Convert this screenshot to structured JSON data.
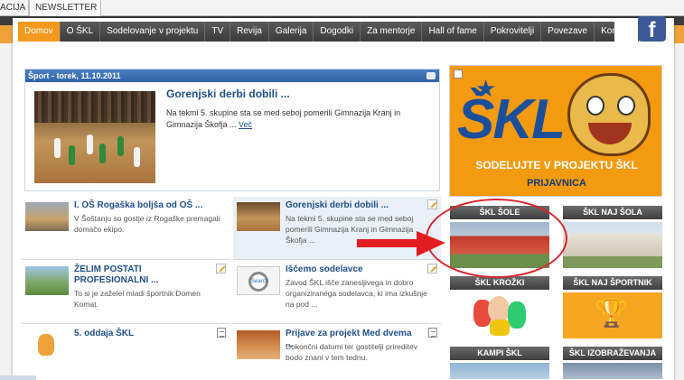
{
  "top_tabs": [
    "ACIJA",
    "NEWSLETTER"
  ],
  "nav": {
    "items": [
      "Domov",
      "O ŠKL",
      "Sodelovanje v projektu",
      "TV",
      "Revija",
      "Galerija",
      "Dogodki",
      "Za mentorje",
      "Hall of fame",
      "Pokrovitelji",
      "Povezave",
      "Kontakt"
    ],
    "active": "Domov",
    "facebook": "f"
  },
  "featured": {
    "header": "Šport - torek, 11.10.2011",
    "title": "Gorenjski derbi dobili ...",
    "text": "Na tekmi 5. skupine sta se med seboj pomerili Gimnazija Kranj in Gimnazija Škofja ...",
    "more": "Več"
  },
  "articles": [
    {
      "title": "I. OŠ Rogaška boljša od OŠ ...",
      "text": "V Šoštanju so gostje iz Rogaške premagali domačo ekipo."
    },
    {
      "title": "Gorenjski derbi dobili ...",
      "text": "Na tekmi 5. skupine sta se med seboj pomerili Gimnazija Kranj in Gimnazija Škofja ..."
    },
    {
      "title": "ŽELIM POSTATI PROFESIONALNI ...",
      "text": "To si je zaželel mladi športnik Domen Komat."
    },
    {
      "title": "Iščemo sodelavce",
      "text": "Zavod ŠKL išče zanesljivega in dobro organiziranega sodelavca, ki ima izkušnje na pod ..."
    },
    {
      "title": "5. oddaja ŠKL",
      "text": ""
    },
    {
      "title": "Prijave za projekt Med dvema ...",
      "text": "Dokončni datumi ter gostitelji prireditev bodo znani v tem tednu."
    }
  ],
  "ad": {
    "logo": "ŠKL",
    "slogan": "SODELUJTE V PROJEKTU ŠKL",
    "signup": "PRIJAVNICA"
  },
  "tiles": [
    "ŠKL ŠOLE",
    "ŠKL NAJ ŠOLA",
    "ŠKL KROŽKI",
    "ŠKL NAJ ŠPORTNIK",
    "KAMPI ŠKL",
    "ŠKL IZOBRAŽEVANJA"
  ],
  "search_thumb_text": "Search",
  "colors": {
    "nav_active": "#f39a1e",
    "link": "#1f4f8b",
    "annotation": "#d9272d",
    "facebook": "#3b5998"
  }
}
